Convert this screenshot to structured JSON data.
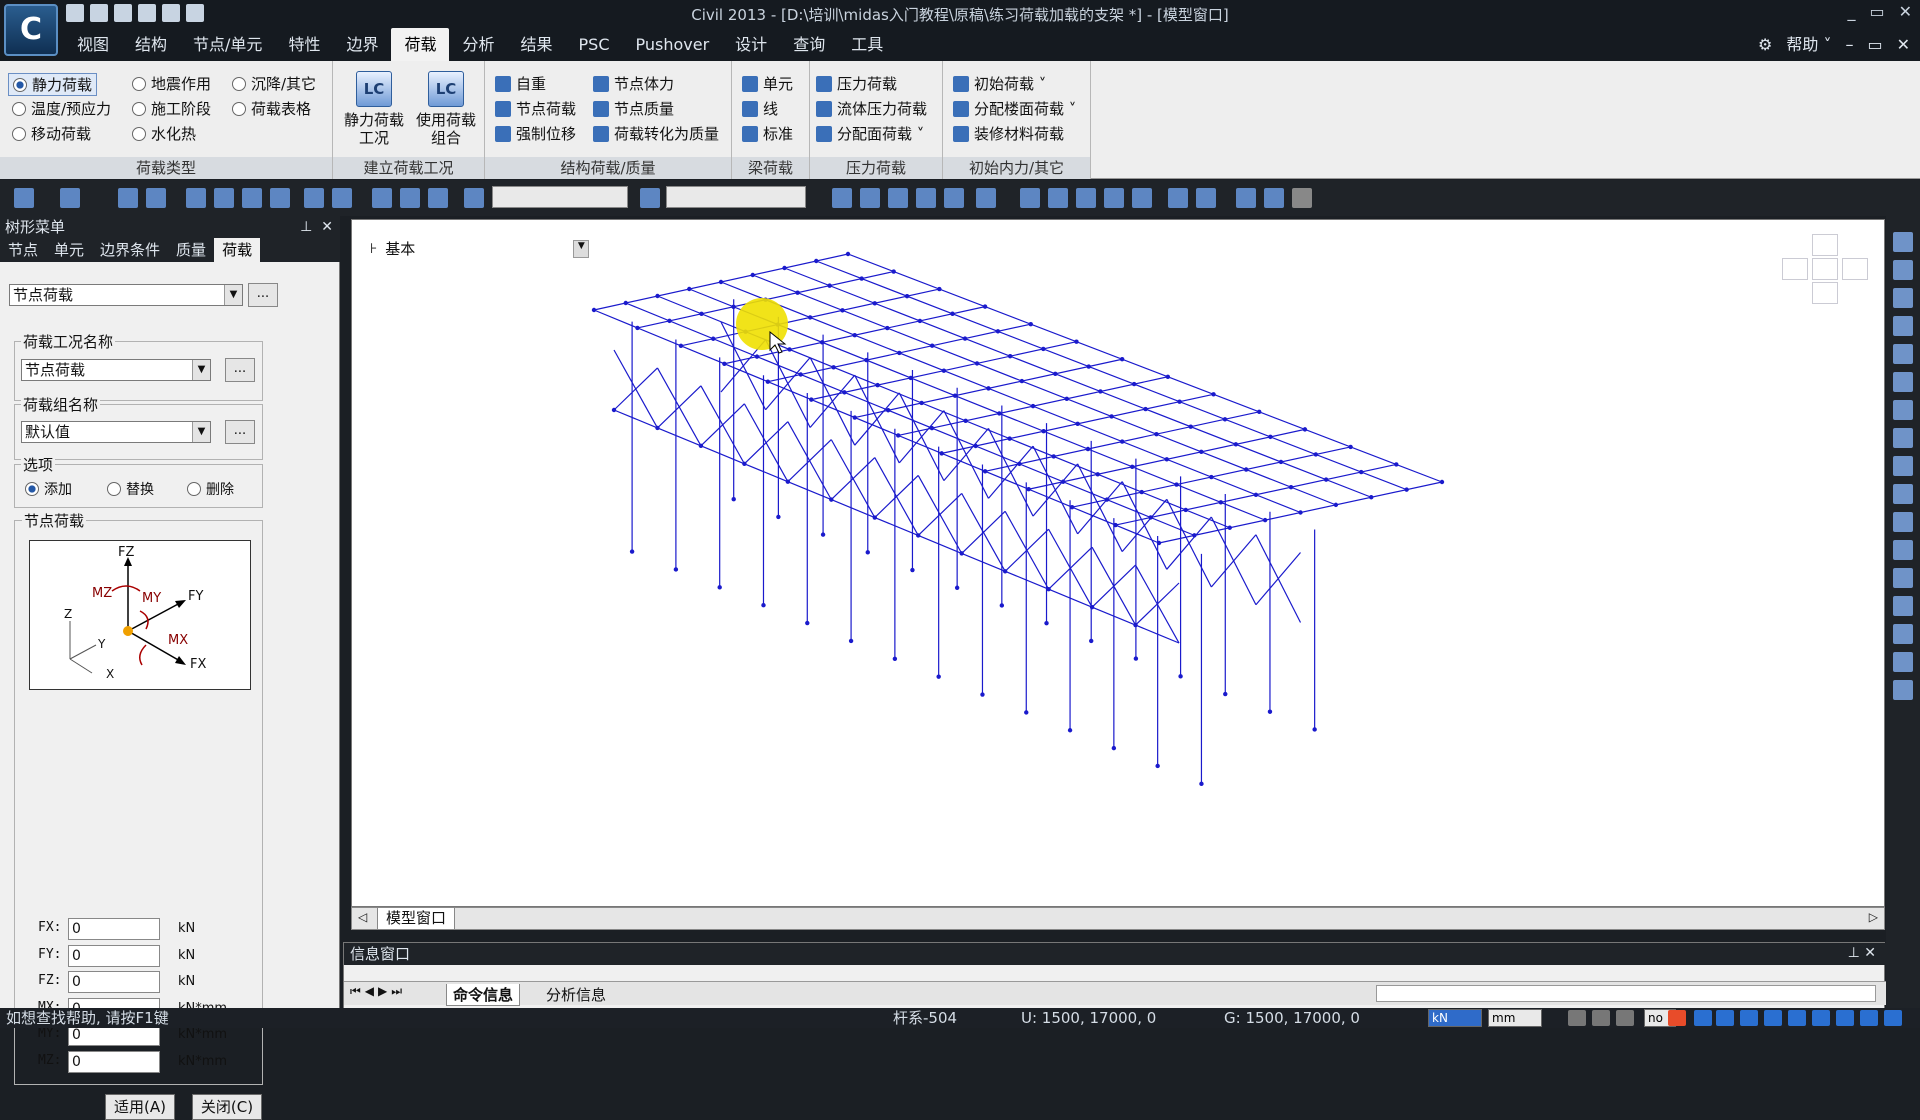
{
  "app": {
    "logo_text": "C",
    "title": "Civil 2013 - [D:\\培训\\midas入门教程\\原稿\\练习荷载加载的支架 *] - [模型窗口]",
    "window_controls": [
      "_",
      "▭",
      "✕"
    ]
  },
  "menu": {
    "items": [
      "视图",
      "结构",
      "节点/单元",
      "特性",
      "边界",
      "荷载",
      "分析",
      "结果",
      "PSC",
      "Pushover",
      "设计",
      "查询",
      "工具"
    ],
    "active": "荷载",
    "help_label": "帮助 ˅"
  },
  "ribbon": {
    "load_type_group": {
      "label": "荷载类型",
      "options": [
        "静力荷载",
        "地震作用",
        "沉降/其它",
        "温度/预应力",
        "施工阶段",
        "荷载表格",
        "移动荷载",
        "水化热"
      ],
      "selected": "静力荷载"
    },
    "create_case_group": {
      "label": "建立荷载工况",
      "static_case": "静力荷载\n工况",
      "use_comb": "使用荷载\n组合",
      "static_icon": "LC",
      "comb_icon": "LC"
    },
    "struct_load_group": {
      "label": "结构荷载/质量",
      "items": [
        "自重",
        "节点体力",
        "节点荷载",
        "节点质量",
        "强制位移",
        "荷载转化为质量"
      ]
    },
    "beam_load_group": {
      "label": "梁荷载",
      "items": [
        "单元",
        "线",
        "标准"
      ]
    },
    "pressure_group": {
      "label": "压力荷载",
      "items": [
        "压力荷载",
        "流体压力荷载",
        "分配面荷载 ˅"
      ]
    },
    "initial_group": {
      "label": "初始内力/其它",
      "items": [
        "初始荷载 ˅",
        "分配楼面荷载 ˅",
        "装修材料荷载"
      ]
    }
  },
  "tree_panel": {
    "title": "树形菜单",
    "tabs": [
      "节点",
      "单元",
      "边界条件",
      "质量",
      "荷载"
    ],
    "active_tab": "荷载",
    "load_type_select": "节点荷载",
    "case_name_label": "荷载工况名称",
    "case_name_value": "节点荷载",
    "group_name_label": "荷载组名称",
    "group_name_value": "默认值",
    "options_label": "选项",
    "options": [
      "添加",
      "替换",
      "删除"
    ],
    "option_selected": "添加",
    "nodal_load_label": "节点荷载",
    "diagram_labels": {
      "fz": "FZ",
      "mz": "MZ",
      "my": "MY",
      "fy": "FY",
      "mx": "MX",
      "fx": "FX",
      "z": "Z",
      "y": "Y",
      "x": "X"
    },
    "fields": [
      {
        "label": "FX:",
        "value": "0",
        "unit": "kN"
      },
      {
        "label": "FY:",
        "value": "0",
        "unit": "kN"
      },
      {
        "label": "FZ:",
        "value": "0",
        "unit": "kN"
      },
      {
        "label": "MX:",
        "value": "0",
        "unit": "kN*mm"
      },
      {
        "label": "MY:",
        "value": "0",
        "unit": "kN*mm"
      },
      {
        "label": "MZ:",
        "value": "0",
        "unit": "kN*mm"
      }
    ],
    "apply_button": "适用(A)",
    "close_button": "关闭(C)",
    "dots": "..."
  },
  "viewport": {
    "view_label": "基本",
    "tab": "模型窗口",
    "wire_color": "#1a1acc",
    "cursor_highlight": "#f0e000"
  },
  "info_panel": {
    "title": "信息窗口",
    "tabs": [
      "命令信息",
      "分析信息"
    ]
  },
  "status": {
    "help": "如想查找帮助, 请按F1键",
    "element": "杆系-504",
    "u_coords": "U: 1500, 17000, 0",
    "g_coords": "G: 1500, 17000, 0",
    "force_unit": "kN",
    "length_unit": "mm",
    "extra": "no"
  }
}
